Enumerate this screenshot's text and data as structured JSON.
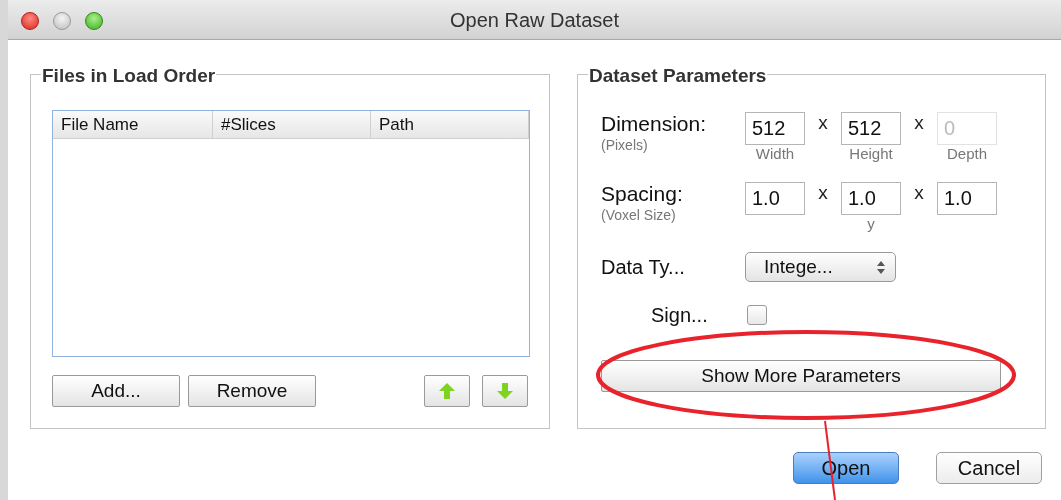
{
  "window": {
    "title": "Open Raw Dataset"
  },
  "files_group": {
    "title": "Files in Load Order",
    "columns": [
      "File Name",
      "#Slices",
      "Path"
    ],
    "buttons": [
      "Add...",
      "Remove"
    ]
  },
  "params_group": {
    "title": "Dataset Parameters",
    "rows": [
      {
        "label": "Dimension:",
        "sublabel": "(Pixels)",
        "fields": [
          {
            "value": "512",
            "caption": "Width",
            "disabled": false
          },
          {
            "value": "512",
            "caption": "Height",
            "disabled": false
          },
          {
            "value": "0",
            "caption": "Depth",
            "disabled": true
          }
        ]
      },
      {
        "label": "Spacing:",
        "sublabel": "(Voxel Size)",
        "fields": [
          {
            "value": "1.0",
            "disabled": false
          },
          {
            "value": "1.0",
            "caption": "y",
            "disabled": false
          },
          {
            "value": "1.0",
            "disabled": false
          }
        ]
      }
    ],
    "data_type": {
      "label": "Data Ty...",
      "value": "Intege..."
    },
    "signed": {
      "label": "Sign...",
      "checked": false
    },
    "more_button": "Show More Parameters"
  },
  "times_signs": [
    "x",
    "x",
    "x",
    "x"
  ],
  "dialog_buttons": [
    {
      "label": "Open",
      "default": true
    },
    {
      "label": "Cancel",
      "default": false
    }
  ]
}
